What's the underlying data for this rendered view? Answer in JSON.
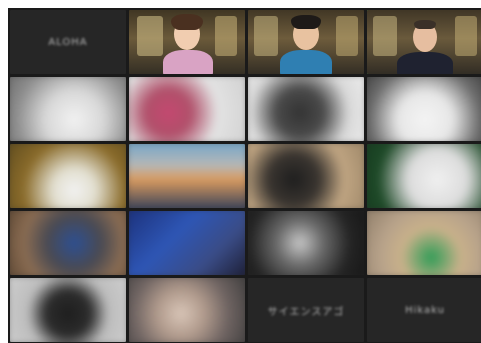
{
  "participants": [
    {
      "label": "ALOHA",
      "video": false
    },
    {
      "video": true
    },
    {
      "video": true
    },
    {
      "video": true
    },
    {
      "video": true
    },
    {
      "video": true
    },
    {
      "video": true
    },
    {
      "video": true
    },
    {
      "video": true
    },
    {
      "video": true
    },
    {
      "video": true
    },
    {
      "video": true
    },
    {
      "video": true
    },
    {
      "video": true
    },
    {
      "video": true
    },
    {
      "video": true
    },
    {
      "video": true
    },
    {
      "video": true
    },
    {
      "label": "サイエンスアゴ",
      "video": false
    },
    {
      "label": "Hikaku",
      "video": false
    }
  ],
  "colors": {
    "background": "#1a1a1a",
    "active_speaker": "#23d959",
    "name_text": "#b9b9b9"
  }
}
